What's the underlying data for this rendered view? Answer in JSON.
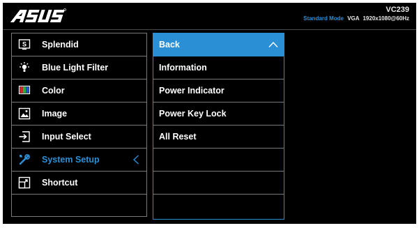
{
  "header": {
    "brand": "ASUS",
    "model": "VC239",
    "mode": "Standard Mode",
    "signal": "VGA",
    "resolution": "1920x1080@60Hz"
  },
  "main_menu": {
    "items": [
      {
        "label": "Splendid",
        "icon": "splendid-icon"
      },
      {
        "label": "Blue Light Filter",
        "icon": "blue-light-icon"
      },
      {
        "label": "Color",
        "icon": "color-icon"
      },
      {
        "label": "Image",
        "icon": "image-icon"
      },
      {
        "label": "Input Select",
        "icon": "input-select-icon"
      },
      {
        "label": "System Setup",
        "icon": "system-setup-icon",
        "active": true
      },
      {
        "label": "Shortcut",
        "icon": "shortcut-icon"
      }
    ]
  },
  "sub_menu": {
    "items": [
      {
        "label": "Back",
        "selected": true
      },
      {
        "label": "Information"
      },
      {
        "label": "Power Indicator"
      },
      {
        "label": "Power Key Lock"
      },
      {
        "label": "All Reset"
      }
    ]
  },
  "colors": {
    "accent": "#2b8fd6",
    "background": "#000000",
    "text": "#ffffff",
    "border": "#7a7a7a"
  }
}
